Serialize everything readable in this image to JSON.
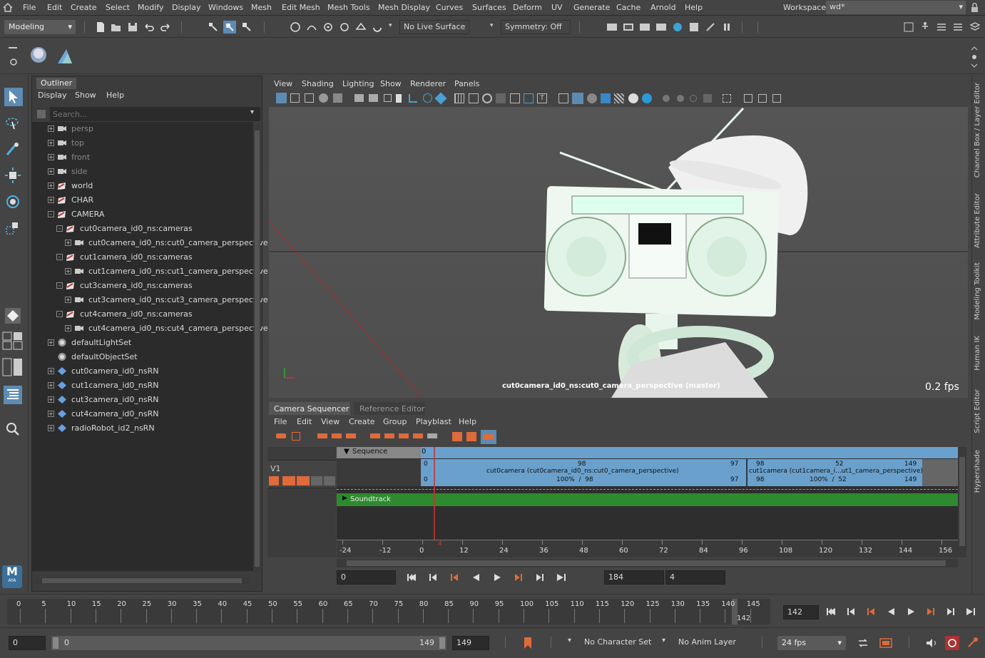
{
  "menubar": {
    "items": [
      "File",
      "Edit",
      "Create",
      "Select",
      "Modify",
      "Display",
      "Windows",
      "Mesh",
      "Edit Mesh",
      "Mesh Tools",
      "Mesh Display",
      "Curves",
      "Surfaces",
      "Deform",
      "UV",
      "Generate",
      "Cache",
      "Arnold",
      "Help"
    ],
    "workspace_label": "Workspace:",
    "workspace_value": "wd*"
  },
  "toolbar": {
    "mode": "Modeling",
    "live_surface": "No Live Surface",
    "symmetry": "Symmetry: Off"
  },
  "outliner": {
    "tab": "Outliner",
    "menu": [
      "Display",
      "Show",
      "Help"
    ],
    "search_placeholder": "Search...",
    "rows": [
      {
        "label": "persp",
        "icon": "camera-icon",
        "depth": 0,
        "exp": "+",
        "dim": true
      },
      {
        "label": "top",
        "icon": "camera-icon",
        "depth": 0,
        "exp": "+",
        "dim": true
      },
      {
        "label": "front",
        "icon": "camera-icon",
        "depth": 0,
        "exp": "+",
        "dim": true
      },
      {
        "label": "side",
        "icon": "camera-icon",
        "depth": 0,
        "exp": "+",
        "dim": true
      },
      {
        "label": "world",
        "icon": "group-icon",
        "depth": 0,
        "exp": "+",
        "dim": false
      },
      {
        "label": "CHAR",
        "icon": "group-icon",
        "depth": 0,
        "exp": "+",
        "dim": false
      },
      {
        "label": "CAMERA",
        "icon": "group-icon",
        "depth": 0,
        "exp": "-",
        "dim": false
      },
      {
        "label": "cut0camera_id0_ns:cameras",
        "icon": "group-icon",
        "depth": 1,
        "exp": "-",
        "dim": false
      },
      {
        "label": "cut0camera_id0_ns:cut0_camera_perspective",
        "icon": "camera-icon",
        "depth": 2,
        "exp": "+",
        "dim": false
      },
      {
        "label": "cut1camera_id0_ns:cameras",
        "icon": "group-icon",
        "depth": 1,
        "exp": "-",
        "dim": false
      },
      {
        "label": "cut1camera_id0_ns:cut1_camera_perspective",
        "icon": "camera-icon",
        "depth": 2,
        "exp": "+",
        "dim": false
      },
      {
        "label": "cut3camera_id0_ns:cameras",
        "icon": "group-icon",
        "depth": 1,
        "exp": "-",
        "dim": false
      },
      {
        "label": "cut3camera_id0_ns:cut3_camera_perspective",
        "icon": "camera-icon",
        "depth": 2,
        "exp": "+",
        "dim": false
      },
      {
        "label": "cut4camera_id0_ns:cameras",
        "icon": "group-icon",
        "depth": 1,
        "exp": "-",
        "dim": false
      },
      {
        "label": "cut4camera_id0_ns:cut4_camera_perspective",
        "icon": "camera-icon",
        "depth": 2,
        "exp": "+",
        "dim": false
      },
      {
        "label": "defaultLightSet",
        "icon": "set-icon",
        "depth": 0,
        "exp": "+",
        "dim": false
      },
      {
        "label": "defaultObjectSet",
        "icon": "set-icon",
        "depth": 0,
        "exp": "",
        "dim": false
      },
      {
        "label": "cut0camera_id0_nsRN",
        "icon": "reference-icon",
        "depth": 0,
        "exp": "+",
        "dim": false
      },
      {
        "label": "cut1camera_id0_nsRN",
        "icon": "reference-icon",
        "depth": 0,
        "exp": "+",
        "dim": false
      },
      {
        "label": "cut3camera_id0_nsRN",
        "icon": "reference-icon",
        "depth": 0,
        "exp": "+",
        "dim": false
      },
      {
        "label": "cut4camera_id0_nsRN",
        "icon": "reference-icon",
        "depth": 0,
        "exp": "+",
        "dim": false
      },
      {
        "label": "radioRobot_id2_nsRN",
        "icon": "reference-icon",
        "depth": 0,
        "exp": "+",
        "dim": false
      }
    ]
  },
  "viewport": {
    "menu": [
      "View",
      "Shading",
      "Lighting",
      "Show",
      "Renderer",
      "Panels"
    ],
    "camera_label": "cut0camera_id0_ns:cut0_camera_perspective (master)",
    "fps": "0.2 fps"
  },
  "sequencer": {
    "tabs": [
      "Camera Sequencer",
      "Reference Editor"
    ],
    "menu": [
      "File",
      "Edit",
      "View",
      "Create",
      "Group",
      "Playblast",
      "Help"
    ],
    "sequence_label": "Sequence",
    "sequence_start": "0",
    "track": "V1",
    "soundtrack": "Soundtrack",
    "shot0": {
      "label": "cut0camera (cut0camera_id0_ns:cut0_camera_perspective)",
      "start": "0",
      "end": "97",
      "start2": "0",
      "end2": "97",
      "seq_start": "98",
      "scale": "100%  /  98"
    },
    "shot1": {
      "label": "cut1camera (cut1camera_i...ut1_camera_perspective)",
      "start": "98",
      "mid": "52",
      "end": "149",
      "start2": "98",
      "end2": "149",
      "scale": "100%  /  52"
    },
    "ruler": [
      "-24",
      "-12",
      "0",
      "12",
      "24",
      "36",
      "48",
      "60",
      "72",
      "84",
      "96",
      "108",
      "120",
      "132",
      "144",
      "156"
    ],
    "current_marker": "4",
    "field_left": "0",
    "field_range": "184",
    "field_cur": "4"
  },
  "timeslider": {
    "ticks": [
      "0",
      "5",
      "10",
      "15",
      "20",
      "25",
      "30",
      "35",
      "40",
      "45",
      "50",
      "55",
      "60",
      "65",
      "70",
      "75",
      "80",
      "85",
      "90",
      "95",
      "100",
      "105",
      "110",
      "115",
      "120",
      "125",
      "130",
      "135",
      "140",
      "145"
    ],
    "current": "142",
    "current_field": "142"
  },
  "rangebar": {
    "start": "0",
    "inner_start": "0",
    "inner_end": "149",
    "end": "149",
    "character_set": "No Character Set",
    "anim_layer": "No Anim Layer",
    "fps": "24 fps"
  },
  "right_tabs": [
    "Channel Box / Layer Editor",
    "Attribute Editor",
    "Modeling Toolkit",
    "Human IK",
    "Script Editor",
    "Hypershade"
  ],
  "logo": "AYA"
}
